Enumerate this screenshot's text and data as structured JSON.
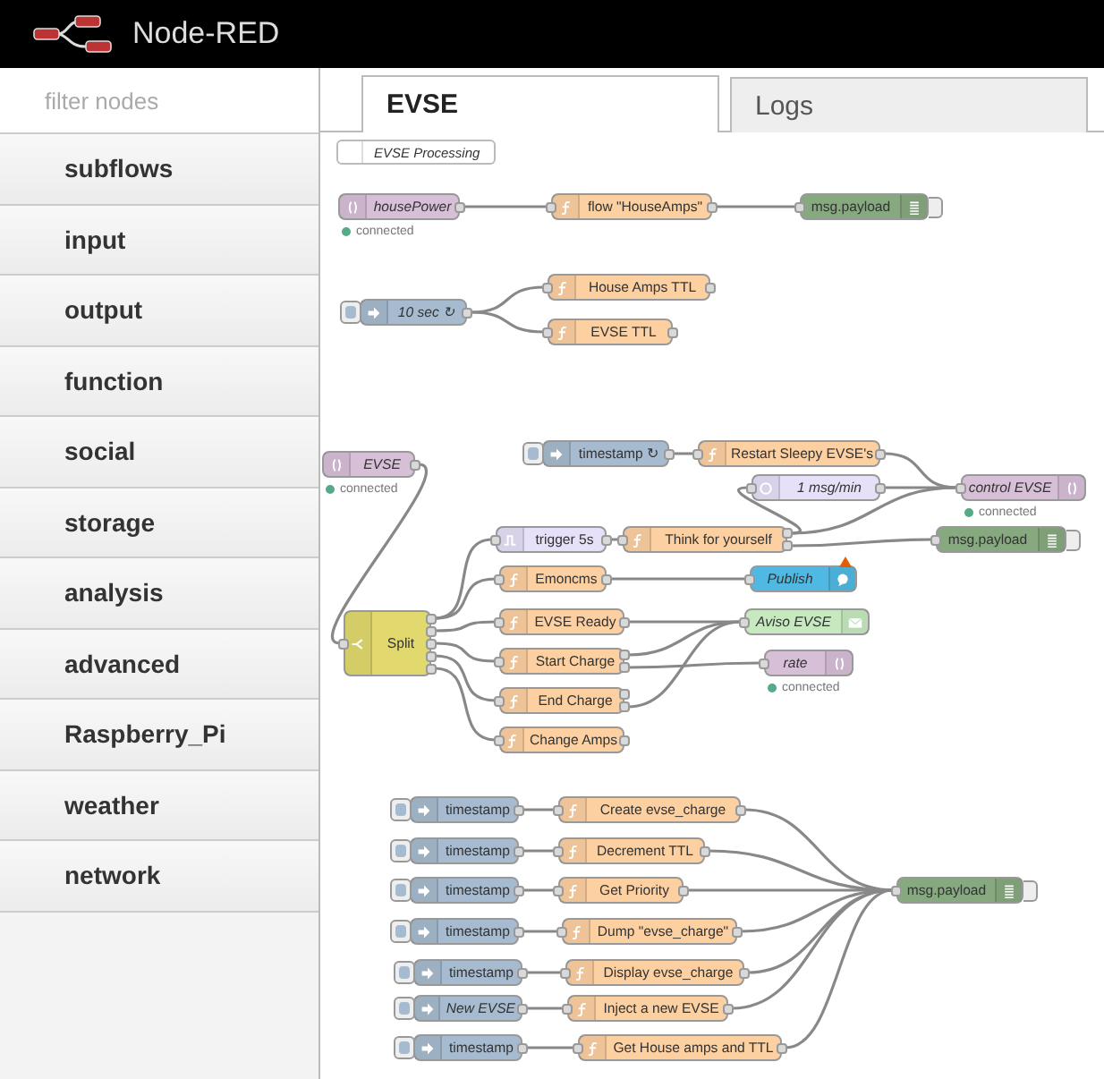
{
  "header": {
    "title": "Node-RED"
  },
  "palette": {
    "placeholder": "filter nodes",
    "categories": [
      "subflows",
      "input",
      "output",
      "function",
      "social",
      "storage",
      "analysis",
      "advanced",
      "Raspberry_Pi",
      "weather",
      "network"
    ]
  },
  "tabs": [
    {
      "label": "EVSE",
      "selected": true
    },
    {
      "label": "Logs",
      "selected": false
    }
  ],
  "flow": {
    "comment": "EVSE Processing",
    "nodes": [
      {
        "kind": "mqtt-in",
        "label": "housePower",
        "italic": true,
        "warning": false,
        "status": "connected"
      },
      {
        "kind": "function",
        "label": "flow \"HouseAmps\"",
        "italic": false,
        "warning": false
      },
      {
        "kind": "debug",
        "label": "msg.payload",
        "italic": false,
        "warning": false
      },
      {
        "kind": "inject",
        "label": "10 sec ↻",
        "italic": true,
        "warning": false
      },
      {
        "kind": "function",
        "label": "House Amps TTL",
        "italic": false,
        "warning": false
      },
      {
        "kind": "function",
        "label": "EVSE TTL",
        "italic": false,
        "warning": false
      },
      {
        "kind": "mqtt-in",
        "label": "EVSE",
        "italic": true,
        "warning": false,
        "status": "connected"
      },
      {
        "kind": "inject",
        "label": "timestamp ↻",
        "italic": false,
        "warning": false
      },
      {
        "kind": "function",
        "label": "Restart Sleepy EVSE's",
        "italic": false,
        "warning": false
      },
      {
        "kind": "delay",
        "label": "1 msg/min",
        "italic": true,
        "warning": false
      },
      {
        "kind": "mqtt-out",
        "label": "control EVSE",
        "italic": true,
        "warning": false,
        "status": "connected"
      },
      {
        "kind": "trigger",
        "label": "trigger 5s",
        "italic": false,
        "warning": false
      },
      {
        "kind": "function",
        "label": "Think for yourself",
        "italic": false,
        "warning": false
      },
      {
        "kind": "debug",
        "label": "msg.payload",
        "italic": false,
        "warning": false
      },
      {
        "kind": "function",
        "label": "Emoncms",
        "italic": false,
        "warning": false
      },
      {
        "kind": "publish",
        "label": "Publish",
        "italic": true,
        "warning": true
      },
      {
        "kind": "switch",
        "label": "Split",
        "italic": false,
        "warning": false
      },
      {
        "kind": "function",
        "label": "EVSE Ready",
        "italic": false,
        "warning": false
      },
      {
        "kind": "email",
        "label": "Aviso EVSE",
        "italic": true,
        "warning": false
      },
      {
        "kind": "function",
        "label": "Start Charge",
        "italic": false,
        "warning": false
      },
      {
        "kind": "mqtt-out",
        "label": "rate",
        "italic": true,
        "warning": false,
        "status": "connected"
      },
      {
        "kind": "function",
        "label": "End Charge",
        "italic": false,
        "warning": false
      },
      {
        "kind": "function",
        "label": "Change Amps",
        "italic": false,
        "warning": false
      },
      {
        "kind": "inject",
        "label": "timestamp",
        "italic": false,
        "warning": false
      },
      {
        "kind": "inject",
        "label": "timestamp",
        "italic": false,
        "warning": false
      },
      {
        "kind": "inject",
        "label": "timestamp",
        "italic": false,
        "warning": false
      },
      {
        "kind": "inject",
        "label": "timestamp",
        "italic": false,
        "warning": false
      },
      {
        "kind": "inject",
        "label": "timestamp",
        "italic": false,
        "warning": false
      },
      {
        "kind": "inject",
        "label": "New EVSE",
        "italic": true,
        "warning": false
      },
      {
        "kind": "inject",
        "label": "timestamp",
        "italic": false,
        "warning": false
      },
      {
        "kind": "function",
        "label": "Create evse_charge",
        "italic": false,
        "warning": false
      },
      {
        "kind": "function",
        "label": "Decrement TTL",
        "italic": false,
        "warning": false
      },
      {
        "kind": "function",
        "label": "Get Priority",
        "italic": false,
        "warning": false
      },
      {
        "kind": "function",
        "label": "Dump \"evse_charge\"",
        "italic": false,
        "warning": false
      },
      {
        "kind": "function",
        "label": "Display evse_charge",
        "italic": false,
        "warning": false
      },
      {
        "kind": "function",
        "label": "Inject a new EVSE",
        "italic": false,
        "warning": false
      },
      {
        "kind": "function",
        "label": "Get House amps and TTL",
        "italic": false,
        "warning": false
      },
      {
        "kind": "debug",
        "label": "msg.payload",
        "italic": false,
        "warning": false
      }
    ]
  }
}
